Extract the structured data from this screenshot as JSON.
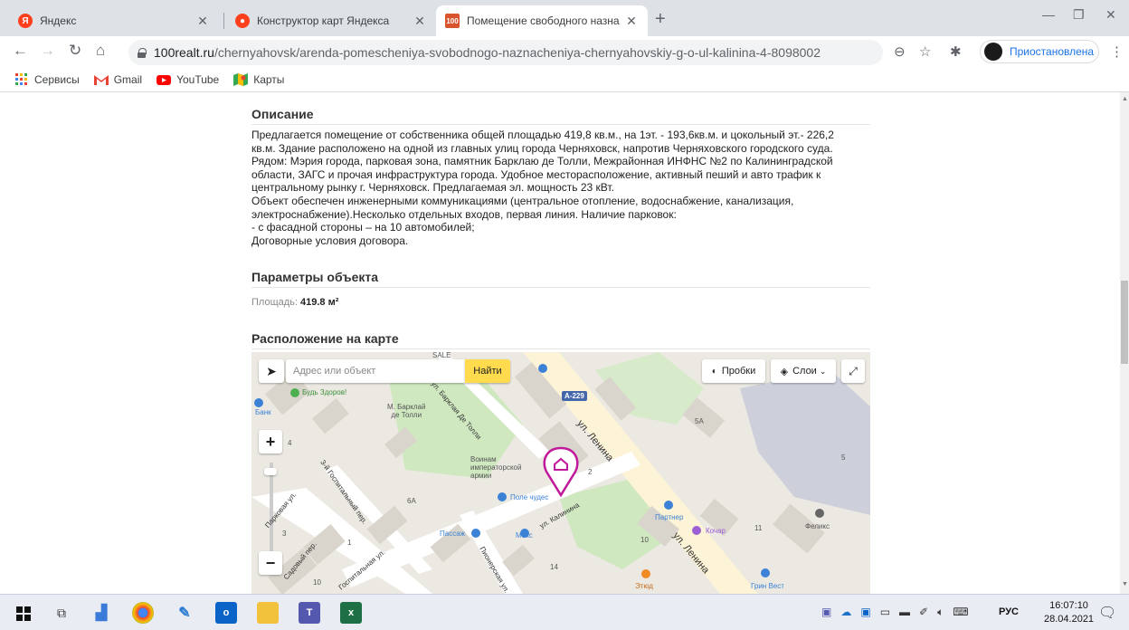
{
  "browser": {
    "tabs": [
      {
        "title": "Яндекс",
        "favicon": "yandex-icon",
        "color": "#fc3f1d"
      },
      {
        "title": "Конструктор карт Яндекса",
        "favicon": "yandex-maps-constructor-icon",
        "color": "#fc3f1d"
      },
      {
        "title": "Помещение свободного назна",
        "favicon": "100realt-icon",
        "color": "#d9532c"
      }
    ],
    "url_host": "100realt.ru",
    "url_path": "/chernyahovsk/arenda-pomescheniya-svobodnogo-naznacheniya-chernyahovskiy-g-o-ul-kalinina-4-8098002",
    "profile_label": "Приостановлена",
    "bookmarks": [
      {
        "label": "Сервисы",
        "icon": "apps-grid-icon"
      },
      {
        "label": "Gmail",
        "icon": "gmail-icon"
      },
      {
        "label": "YouTube",
        "icon": "youtube-icon"
      },
      {
        "label": "Карты",
        "icon": "maps-icon"
      }
    ]
  },
  "page": {
    "description_title": "Описание",
    "description_text": "Предлагается помещение от собственника общей площадью 419,8 кв.м., на 1эт. - 193,6кв.м. и цокольный эт.- 226,2\nкв.м. Здание расположено на одной из главных улиц города Черняховск, напротив Черняховского городского суда.\nРядом: Мэрия города, парковая зона, памятник Барклаю де Толли, Межрайонная ИНФНС №2 по Калининградской\nобласти, ЗАГС и прочая инфраструктура города. Удобное месторасположение, активный пеший и авто трафик к\nцентральному рынку г. Черняховск. Предлагаемая эл. мощность 23 кВт.\nОбъект обеспечен инженерными коммуникациями (центральное отопление, водоснабжение, канализация,\nэлектроснабжение).Несколько отдельных входов, первая линия. Наличие парковок:\n- с фасадной стороны – на 10 автомобилей;\nДоговорные условия договора.",
    "params_title": "Параметры объекта",
    "area_label": "Площадь:",
    "area_value": "419.8 м²",
    "map_title": "Расположение на карте"
  },
  "map": {
    "search_placeholder": "Адрес или объект",
    "search_button": "Найти",
    "traffic_button": "Пробки",
    "layers_button": "Слои",
    "zoom_in": "+",
    "zoom_out": "−",
    "labels": {
      "budz_zdorov": "Будь Здоров!",
      "bank": "Банк",
      "monument": "М. Барклай\nде Толли",
      "warriors": "Воинам\nимператорской\nармии",
      "pole_chudes": "Поле чудес",
      "passage": "Пассаж",
      "maks": "Макс",
      "partner": "Партнер",
      "kochar": "Кочар",
      "feliks": "Феликс",
      "green_west": "Грин Вест",
      "etud": "Этюд",
      "road_badge": "А-229",
      "sale": "SALE"
    },
    "streets": {
      "lenina1": "ул. Ленина",
      "lenina2": "ул. Ленина",
      "kalinina": "ул. Калинина",
      "barklaya": "ул. Барклая Де Толли",
      "parkovaya": "Парковая ул.",
      "gospital3": "3-й Госпитальный пер.",
      "sadovy": "Садовый пер.",
      "gospitalnaya": "Госпитальная ул.",
      "pionerskaya": "Пионерская ул."
    },
    "house_numbers": [
      "5А",
      "5",
      "6А",
      "2",
      "11",
      "10",
      "14",
      "10",
      "3",
      "1",
      "4"
    ],
    "pin_color": "#c0199a"
  },
  "taskbar": {
    "lang": "РУС",
    "time": "16:07:10",
    "date": "28.04.2021",
    "apps": [
      {
        "name": "start-icon"
      },
      {
        "name": "task-view-icon"
      },
      {
        "name": "chart-app-icon"
      },
      {
        "name": "chrome-icon"
      },
      {
        "name": "paint-icon"
      },
      {
        "name": "outlook-icon"
      },
      {
        "name": "file-explorer-icon"
      },
      {
        "name": "teams-icon"
      },
      {
        "name": "excel-icon"
      }
    ]
  }
}
